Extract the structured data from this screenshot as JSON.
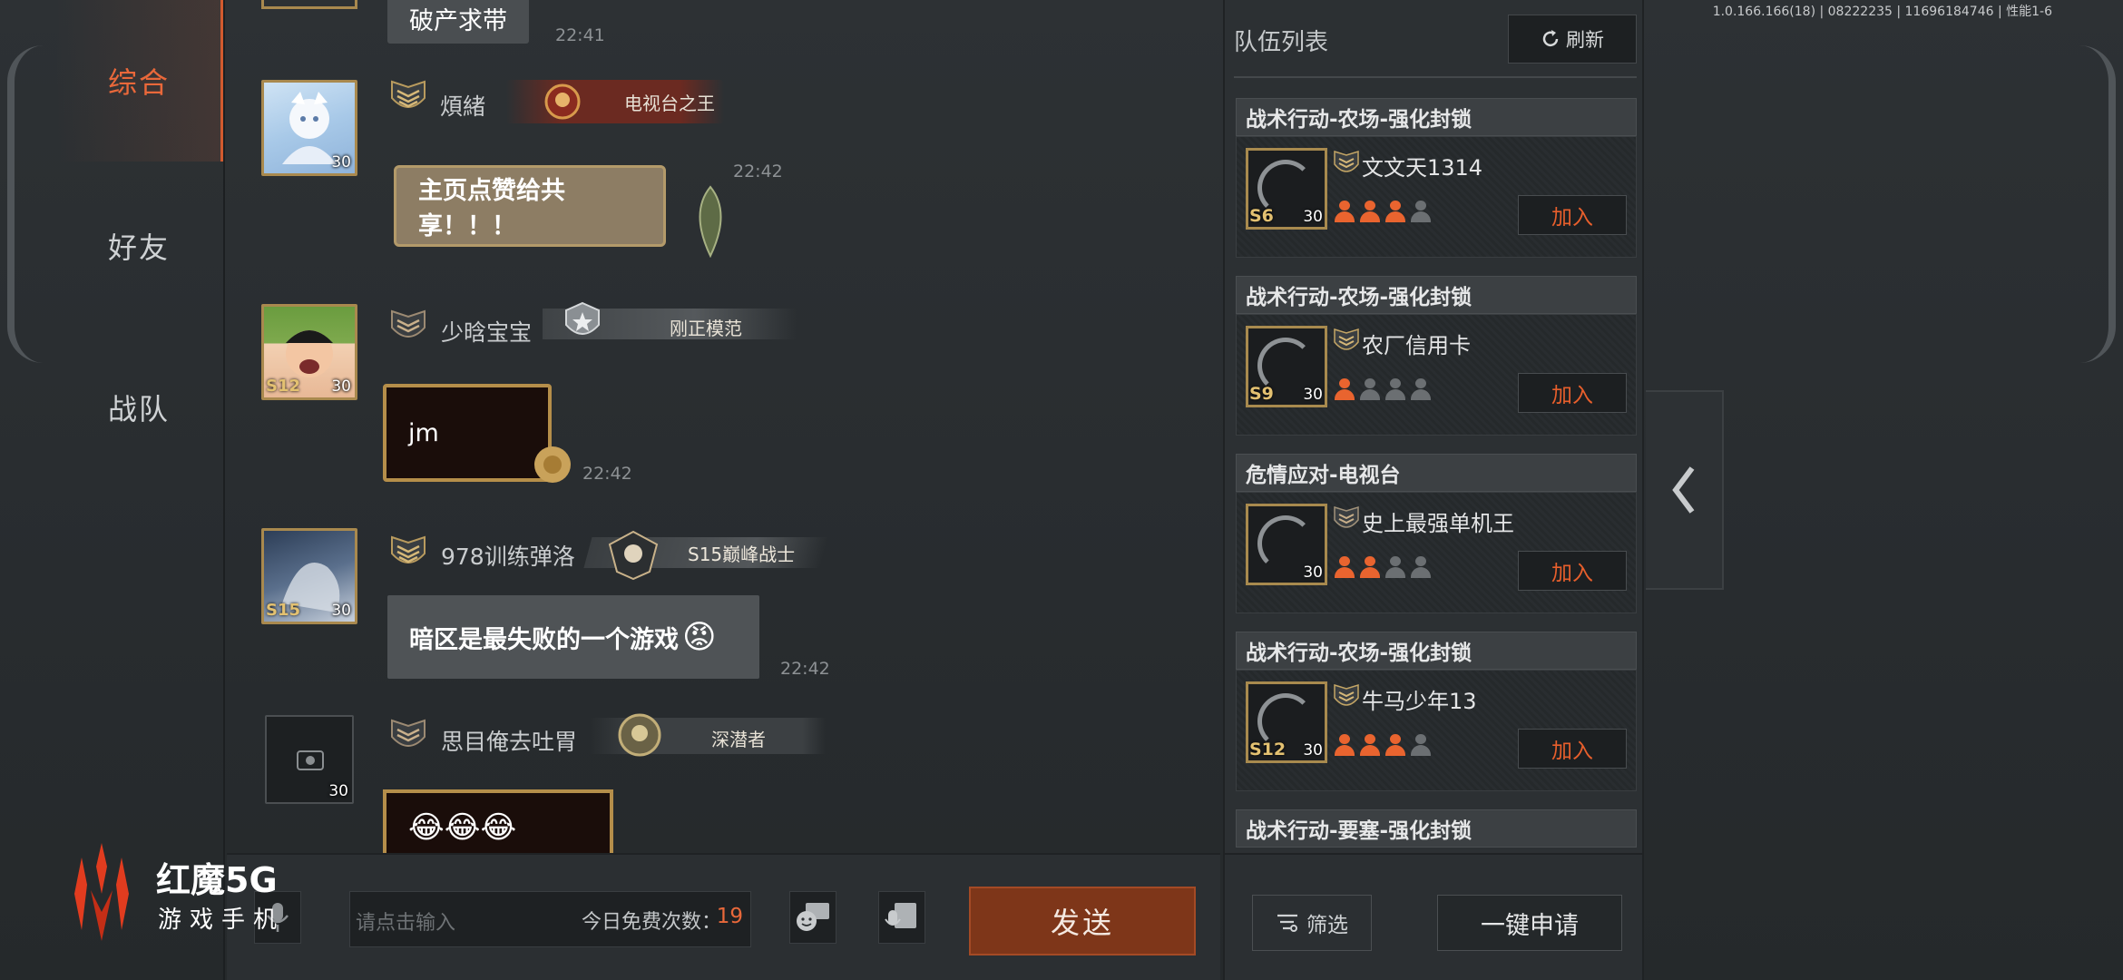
{
  "build_info": "1.0.166.166(18) | 08222235 | 11696184746 | 性能1-6",
  "side_tabs": [
    {
      "label": "综合",
      "active": true
    },
    {
      "label": "好友",
      "active": false
    },
    {
      "label": "战队",
      "active": false
    }
  ],
  "chat": {
    "messages": [
      {
        "text": "破产求带",
        "time": "22:41"
      },
      {
        "name": "煩緒",
        "rank_icon": "rank-emblem-icon",
        "title": "电视台之王",
        "level": "30",
        "text": "主页点赞给共享！！！",
        "time": "22:42"
      },
      {
        "name": "少晗宝宝",
        "rank_icon": "rank-emblem-icon",
        "title": "刚正模范",
        "season": "S12",
        "level": "30",
        "text": "jm",
        "time": "22:42"
      },
      {
        "name": "978训练弹洛",
        "rank_icon": "rank-emblem-icon",
        "title": "S15巅峰战士",
        "season": "S15",
        "level": "30",
        "text": "暗区是最失败的一个游戏",
        "time": "22:42"
      },
      {
        "name": "思目俺去吐胃",
        "rank_icon": "rank-emblem-icon",
        "title": "深潜者",
        "level": "30",
        "text": "😂😂😂",
        "time": ""
      }
    ]
  },
  "input": {
    "placeholder": "请点击输入",
    "free_label": "今日免费次数：",
    "free_count": "19",
    "send_label": "发送"
  },
  "team_panel": {
    "title": "队伍列表",
    "refresh_label": "刷新",
    "teams": [
      {
        "mode": "战术行动-农场-强化封锁",
        "leader": "文文天1314",
        "season": "S6",
        "level": "30",
        "filled": 3,
        "total": 4,
        "join_label": "加入"
      },
      {
        "mode": "战术行动-农场-强化封锁",
        "leader": "农厂信用卡",
        "season": "S9",
        "level": "30",
        "filled": 1,
        "total": 4,
        "join_label": "加入"
      },
      {
        "mode": "危情应对-电视台",
        "leader": "史上最强单机王",
        "season": "",
        "level": "30",
        "filled": 2,
        "total": 4,
        "join_label": "加入"
      },
      {
        "mode": "战术行动-农场-强化封锁",
        "leader": "牛马少年13",
        "season": "S12",
        "level": "30",
        "filled": 3,
        "total": 4,
        "join_label": "加入"
      },
      {
        "mode": "战术行动-要塞-强化封锁"
      }
    ],
    "filter_label": "筛选",
    "apply_all_label": "一键申请"
  },
  "brand": {
    "title": "红魔5G",
    "subtitle": "游戏手机"
  },
  "colors": {
    "accent": "#e9683a",
    "send_button": "#7e3619",
    "gold_frame": "#a9894e"
  }
}
